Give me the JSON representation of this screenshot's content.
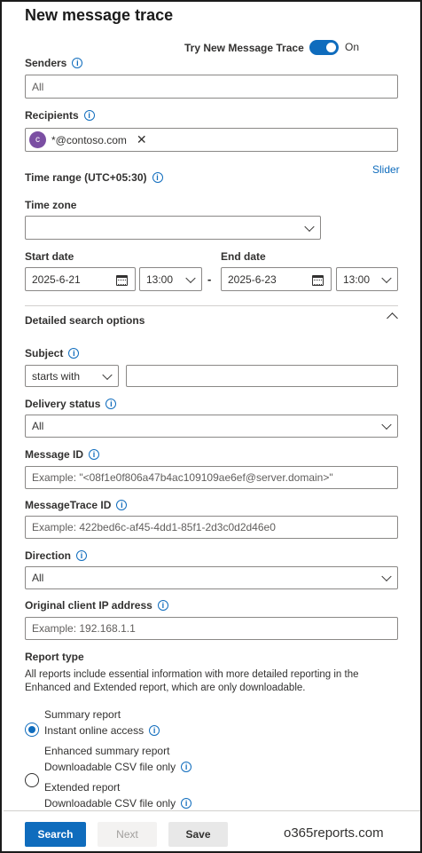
{
  "title": "New message trace",
  "toggle": {
    "label": "Try New Message Trace",
    "state": "On"
  },
  "senders": {
    "label": "Senders",
    "placeholder": "All"
  },
  "recipients": {
    "label": "Recipients",
    "chip": {
      "initial": "c",
      "text": "*@contoso.com"
    }
  },
  "time_range": {
    "label": "Time range (UTC+05:30)",
    "slider_link": "Slider"
  },
  "time_zone": {
    "label": "Time zone",
    "value": ""
  },
  "start": {
    "label": "Start date",
    "date": "2025-6-21",
    "time": "13:00"
  },
  "end": {
    "label": "End date",
    "date": "2025-6-23",
    "time": "13:00"
  },
  "range_separator": "-",
  "detailed": {
    "label": "Detailed search options"
  },
  "subject": {
    "label": "Subject",
    "operator": "starts with",
    "value": ""
  },
  "delivery_status": {
    "label": "Delivery status",
    "value": "All"
  },
  "message_id": {
    "label": "Message ID",
    "placeholder": "Example: \"<08f1e0f806a47b4ac109109ae6ef@server.domain>\""
  },
  "trace_id": {
    "label": "MessageTrace ID",
    "placeholder": "Example: 422bed6c-af45-4dd1-85f1-2d3c0d2d46e0"
  },
  "direction": {
    "label": "Direction",
    "value": "All"
  },
  "client_ip": {
    "label": "Original client IP address",
    "placeholder": "Example: 192.168.1.1"
  },
  "report_type": {
    "label": "Report type",
    "description_line1": "All reports include essential information with more detailed reporting in the",
    "description_line2": "Enhanced and Extended report, which are only downloadable.",
    "options": [
      {
        "title": "Summary report",
        "subtitle": "Instant online access",
        "selected": true
      },
      {
        "title": "Enhanced summary report",
        "subtitle": "Downloadable CSV file only",
        "selected": false
      },
      {
        "title": "Extended report",
        "subtitle": "Downloadable CSV file only",
        "selected": false
      }
    ]
  },
  "footer": {
    "search": "Search",
    "next": "Next",
    "save": "Save",
    "watermark": "o365reports.com"
  },
  "colors": {
    "accent": "#0f6cbd",
    "avatar": "#7b4fa3"
  },
  "icons": {
    "info": "info-icon",
    "chevron": "chevron-down-icon",
    "calendar": "calendar-icon",
    "dismiss": "close-icon"
  }
}
